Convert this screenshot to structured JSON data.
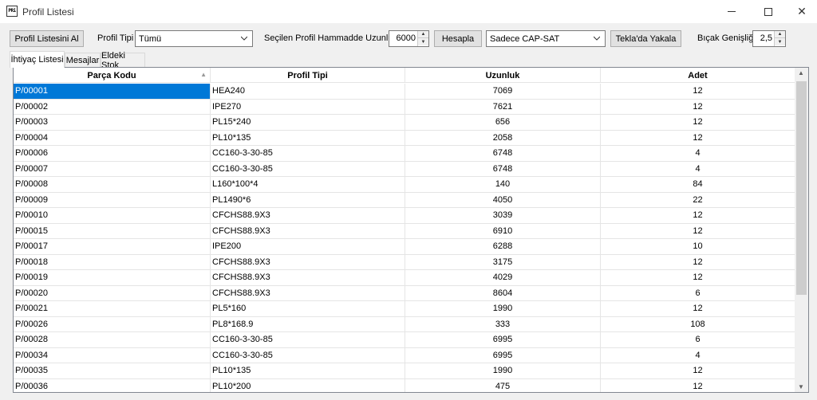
{
  "window": {
    "icon_text": "PRi",
    "title": "Profil Listesi",
    "close_glyph": "✕"
  },
  "toolbar": {
    "get_list_label": "Profil Listesini Al",
    "profile_type_label": "Profil Tipi",
    "profile_type_value": "Tümü",
    "length_label": "Seçilen Profil Hammadde Uzunluğu",
    "length_value": "6000",
    "calc_label": "Hesapla",
    "filter_value": "Sadece CAP-SAT",
    "tekla_label": "Tekla'da Yakala",
    "blade_label": "Bıçak Genişliği",
    "blade_value": "2,5"
  },
  "tabs": [
    {
      "label": "İhtiyaç Listesi",
      "active": true
    },
    {
      "label": "Mesajlar",
      "active": false
    },
    {
      "label": "Eldeki Stok",
      "active": false
    }
  ],
  "table": {
    "columns": [
      "Parça Kodu",
      "Profil Tipi",
      "Uzunluk",
      "Adet"
    ],
    "rows": [
      [
        "P/00001",
        "HEA240",
        "7069",
        "12"
      ],
      [
        "P/00002",
        "IPE270",
        "7621",
        "12"
      ],
      [
        "P/00003",
        "PL15*240",
        "656",
        "12"
      ],
      [
        "P/00004",
        "PL10*135",
        "2058",
        "12"
      ],
      [
        "P/00006",
        "CC160-3-30-85",
        "6748",
        "4"
      ],
      [
        "P/00007",
        "CC160-3-30-85",
        "6748",
        "4"
      ],
      [
        "P/00008",
        "L160*100*4",
        "140",
        "84"
      ],
      [
        "P/00009",
        "PL1490*6",
        "4050",
        "22"
      ],
      [
        "P/00010",
        "CFCHS88.9X3",
        "3039",
        "12"
      ],
      [
        "P/00015",
        "CFCHS88.9X3",
        "6910",
        "12"
      ],
      [
        "P/00017",
        "IPE200",
        "6288",
        "10"
      ],
      [
        "P/00018",
        "CFCHS88.9X3",
        "3175",
        "12"
      ],
      [
        "P/00019",
        "CFCHS88.9X3",
        "4029",
        "12"
      ],
      [
        "P/00020",
        "CFCHS88.9X3",
        "8604",
        "6"
      ],
      [
        "P/00021",
        "PL5*160",
        "1990",
        "12"
      ],
      [
        "P/00026",
        "PL8*168.9",
        "333",
        "108"
      ],
      [
        "P/00028",
        "CC160-3-30-85",
        "6995",
        "6"
      ],
      [
        "P/00034",
        "CC160-3-30-85",
        "6995",
        "4"
      ],
      [
        "P/00035",
        "PL10*135",
        "1990",
        "12"
      ],
      [
        "P/00036",
        "PL10*200",
        "475",
        "12"
      ]
    ],
    "selected_row": 0
  },
  "colors": {
    "selection": "#0078d7",
    "window_bg": "#f0f0f0"
  }
}
